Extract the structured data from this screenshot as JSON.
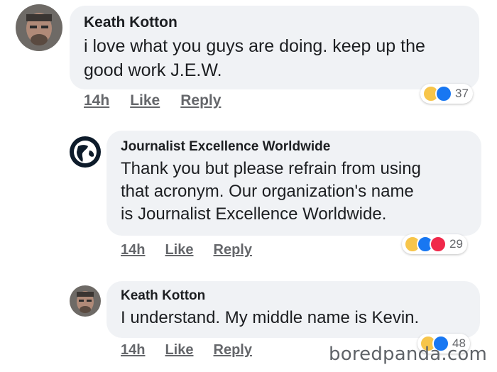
{
  "comments": [
    {
      "author": "Keath Kotton",
      "text_lines": [
        "i love what you guys are doing.  keep up the",
        "good work J.E.W."
      ],
      "time": "14h",
      "like_label": "Like",
      "reply_label": "Reply",
      "reactions": [
        "haha",
        "like"
      ],
      "reaction_count": "37"
    },
    {
      "author": "Journalist Excellence Worldwide",
      "text_lines": [
        "Thank you but please refrain from using",
        "that acronym. Our organization's name",
        "is Journalist Excellence Worldwide."
      ],
      "time": "14h",
      "like_label": "Like",
      "reply_label": "Reply",
      "reactions": [
        "haha",
        "like",
        "love"
      ],
      "reaction_count": "29"
    },
    {
      "author": "Keath Kotton",
      "text_lines": [
        "I understand.  My middle name is Kevin."
      ],
      "time": "14h",
      "like_label": "Like",
      "reply_label": "Reply",
      "reactions": [
        "haha",
        "like"
      ],
      "reaction_count": "48"
    }
  ],
  "watermark": "boredpanda.com",
  "colors": {
    "bubble": "#f0f2f5",
    "meta_text": "#65676b",
    "like_blue": "#1877f2",
    "love_red": "#f0284a",
    "haha_yellow": "#f7c54a"
  }
}
